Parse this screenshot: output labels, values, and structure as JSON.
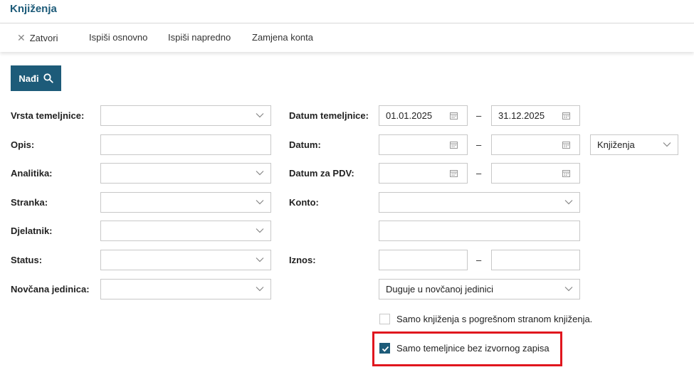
{
  "header": {
    "title": "Knjiženja"
  },
  "toolbar": {
    "close_label": "Zatvori",
    "print_basic_label": "Ispiši osnovno",
    "print_advanced_label": "Ispiši napredno",
    "swap_accounts_label": "Zamjena konta"
  },
  "search": {
    "find_label": "Nađi"
  },
  "labels": {
    "vrsta": "Vrsta temeljnice:",
    "opis": "Opis:",
    "analitika": "Analitika:",
    "stranka": "Stranka:",
    "djelatnik": "Djelatnik:",
    "status": "Status:",
    "valuta": "Novčana jedinica:",
    "datum_temeljnice": "Datum temeljnice:",
    "datum": "Datum:",
    "datum_pdv": "Datum za PDV:",
    "konto": "Konto:",
    "iznos": "Iznos:"
  },
  "values": {
    "datum_temeljnice_od": "01.01.2025",
    "datum_temeljnice_do": "31.12.2025",
    "datum_type": "Knjiženja",
    "iznos_mode": "Duguje u novčanoj jedinici"
  },
  "separator": "–",
  "checkboxes": {
    "wrong_side": {
      "label": "Samo knjiženja s pogrešnom stranom knjiženja.",
      "checked": false
    },
    "no_source": {
      "label": "Samo temeljnice bez izvornog zapisa",
      "checked": true
    }
  },
  "colors": {
    "brand": "#1d5b79",
    "highlight": "#e0161e"
  }
}
